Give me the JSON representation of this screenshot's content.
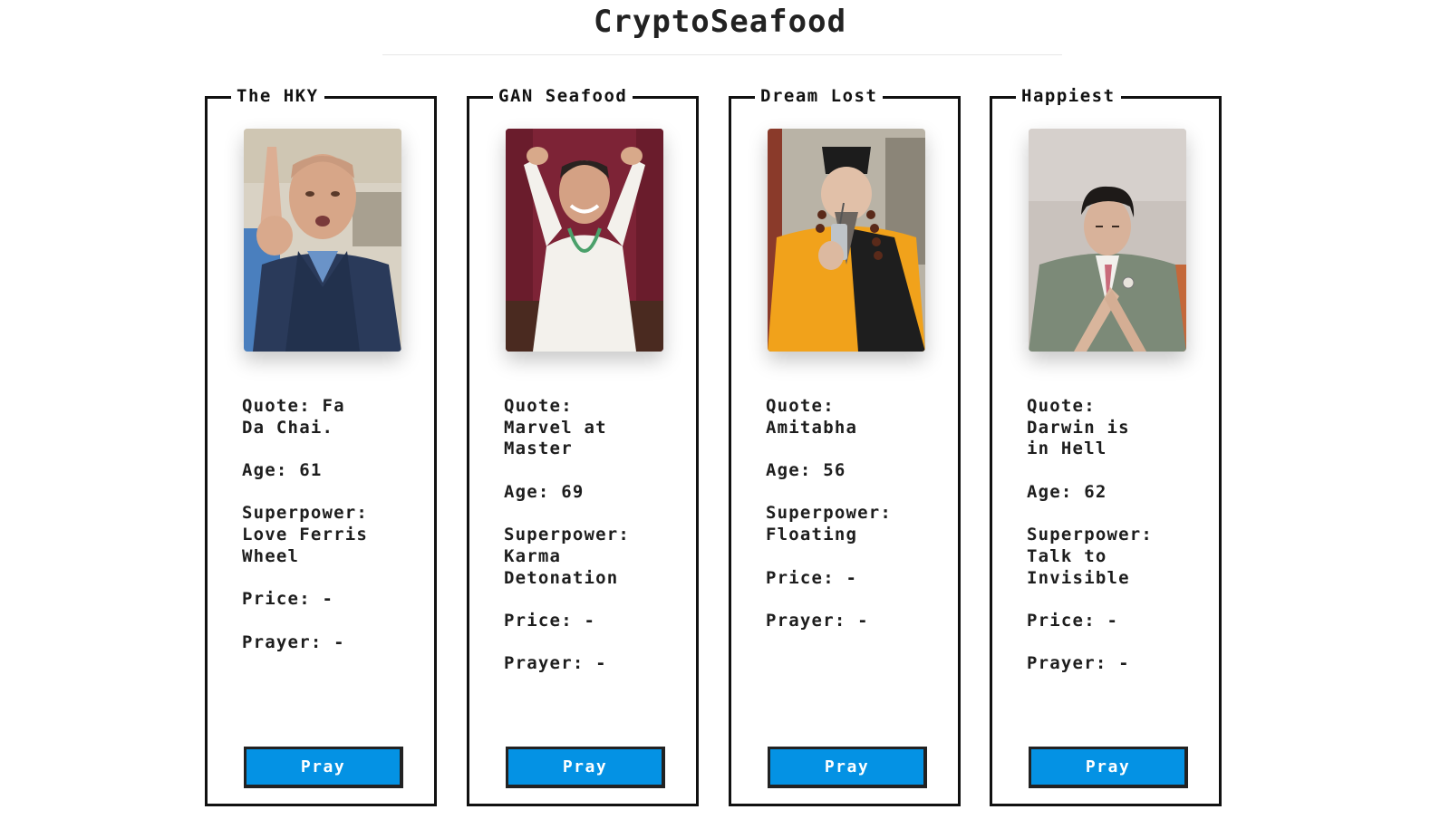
{
  "site": {
    "title": "CryptoSeafood"
  },
  "cards": [
    {
      "name": "The HKY",
      "quote": "Quote: Fa\nDa Chai.",
      "age": "Age: 61",
      "superpower": "Superpower:\nLove Ferris\nWheel",
      "price": "Price: -",
      "prayer": "Prayer: -",
      "button": "Pray",
      "photo_alt": "portrait of a man in a blue shirt and navy vest pointing upward"
    },
    {
      "name": "GAN Seafood",
      "quote": "Quote:\nMarvel at\nMaster",
      "age": "Age: 69",
      "superpower": "Superpower:\nKarma\nDetonation",
      "price": "Price: -",
      "prayer": "Prayer: -",
      "button": "Pray",
      "photo_alt": "man in white outfit making a heart shape with arms"
    },
    {
      "name": "Dream Lost",
      "quote": "Quote:\nAmitabha",
      "age": "Age: 56",
      "superpower": "Superpower:\nFloating",
      "price": "Price: -",
      "prayer": "Prayer: -",
      "button": "Pray",
      "photo_alt": "robed figure in yellow and black with prayer beads drinking through a straw"
    },
    {
      "name": "Happiest",
      "quote": "Quote:\nDarwin is\nin Hell",
      "age": "Age: 62",
      "superpower": "Superpower:\nTalk to\nInvisible",
      "price": "Price: -",
      "prayer": "Prayer: -",
      "button": "Pray",
      "photo_alt": "man in grey suit with crossed hands and eyes closed"
    }
  ],
  "colors": {
    "button": "#0492e4",
    "border": "#111111"
  }
}
